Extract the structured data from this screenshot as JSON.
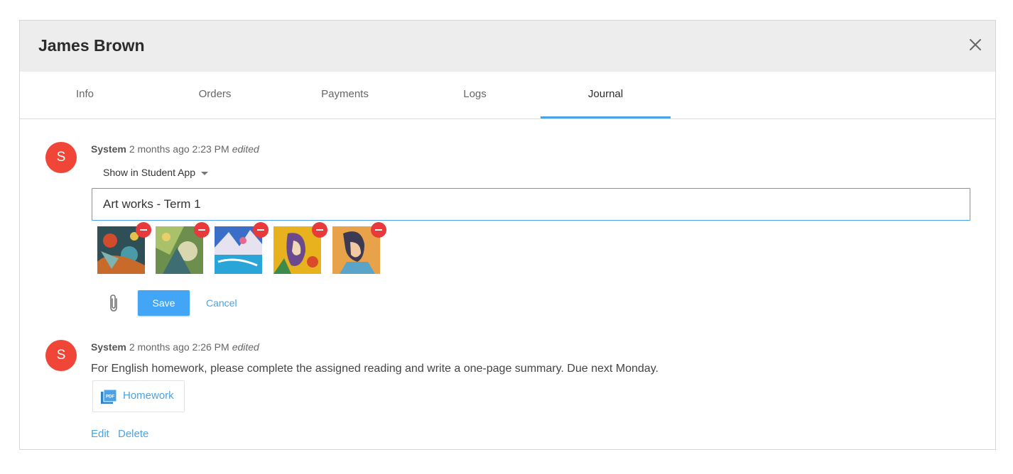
{
  "modal": {
    "title": "James Brown"
  },
  "tabs": [
    {
      "label": "Info"
    },
    {
      "label": "Orders"
    },
    {
      "label": "Payments"
    },
    {
      "label": "Logs"
    },
    {
      "label": "Journal",
      "active": true
    }
  ],
  "entries": [
    {
      "avatar_letter": "S",
      "author": "System",
      "time": "2 months ago 2:23 PM",
      "edited": "edited",
      "visibility": "Show in Student App",
      "input_value": "Art works - Term 1",
      "thumbnails": [
        {
          "icon": "artwork-thumbnail"
        },
        {
          "icon": "artwork-thumbnail"
        },
        {
          "icon": "artwork-thumbnail"
        },
        {
          "icon": "artwork-thumbnail"
        },
        {
          "icon": "artwork-thumbnail"
        }
      ],
      "save_label": "Save",
      "cancel_label": "Cancel"
    },
    {
      "avatar_letter": "S",
      "author": "System",
      "time": "2 months ago 2:26 PM",
      "edited": "edited",
      "text": "For English homework, please complete the assigned reading and write a one-page summary.  Due next Monday.",
      "attachment": {
        "label": "Homework",
        "icon": "pdf-icon"
      },
      "edit_label": "Edit",
      "delete_label": "Delete"
    }
  ],
  "colors": {
    "accent": "#42a5f5",
    "avatar": "#f04638",
    "remove": "#e8393b",
    "header_bg": "#ededed"
  }
}
